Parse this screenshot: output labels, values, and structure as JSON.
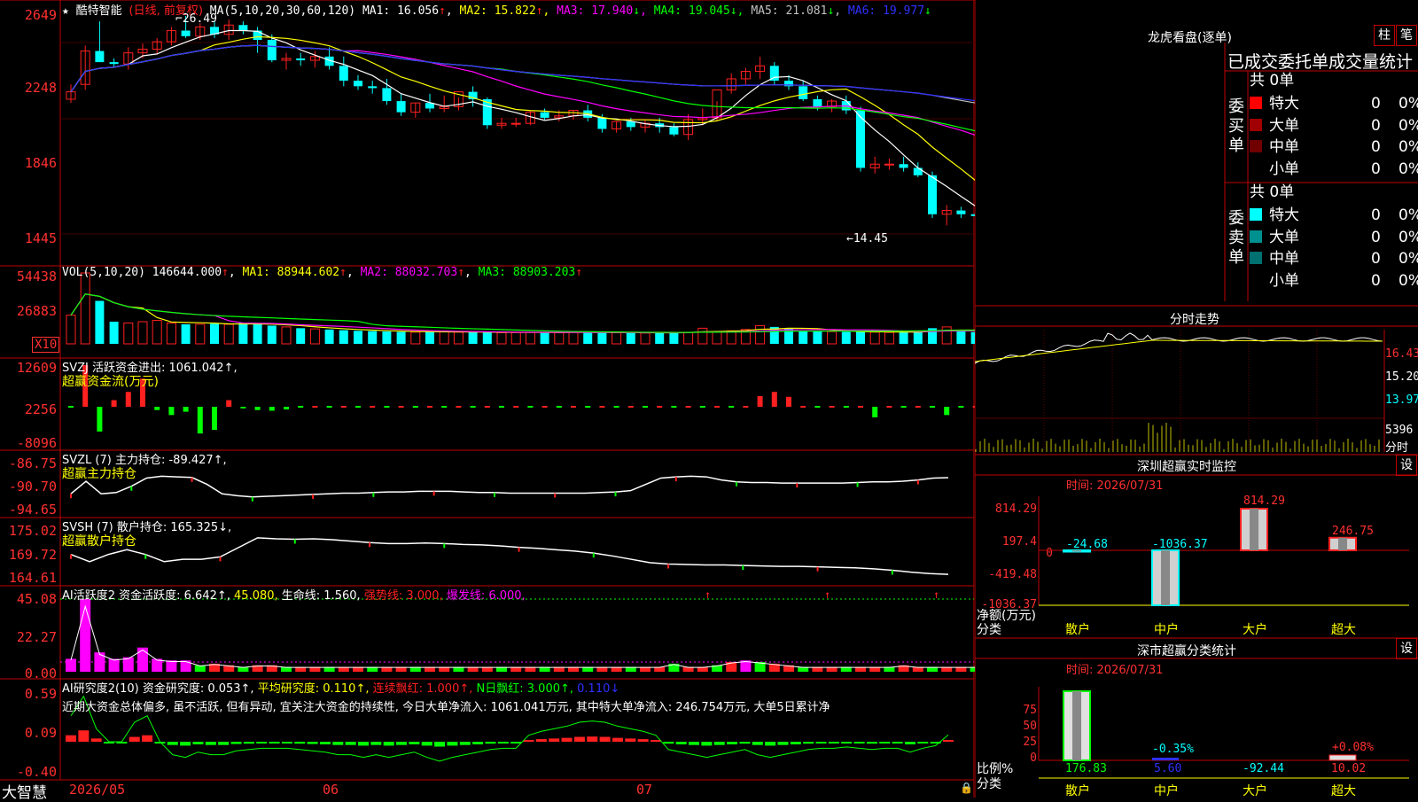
{
  "app": {
    "logo_text": "大智慧",
    "date_labels": [
      "2026/05",
      "06",
      "07"
    ]
  },
  "colors": {
    "up": "#ff2020",
    "down": "#00ffff",
    "ma1": "#ffffff",
    "ma2": "#ffff00",
    "ma3": "#ff00ff",
    "ma4": "#00ff00",
    "ma5": "#c0c0c0",
    "ma6": "#3030ff",
    "grid": "#c00000",
    "axis_text": "#ff3030"
  },
  "main": {
    "star": "★",
    "stock_name": "酷特智能",
    "period": "(日线, 前复权)",
    "ma_params": "MA(5,10,20,30,60,120)",
    "ma_values": [
      {
        "label": "MA1:",
        "value": "16.056",
        "arrow": "↑"
      },
      {
        "label": "MA2:",
        "value": "15.822",
        "arrow": "↑"
      },
      {
        "label": "MA3:",
        "value": "17.940",
        "arrow": "↓"
      },
      {
        "label": "MA4:",
        "value": "19.045",
        "arrow": "↓"
      },
      {
        "label": "MA5:",
        "value": "21.081",
        "arrow": "↓"
      },
      {
        "label": "MA6:",
        "value": "19.977",
        "arrow": "↓"
      }
    ],
    "y_ticks": [
      "2649",
      "2248",
      "1846",
      "1445"
    ],
    "high_label": "26.49",
    "low_label": "←14.45"
  },
  "volume": {
    "title": "VOL(5,10,20)",
    "value": "146644.000",
    "items": [
      {
        "label": "MA1:",
        "value": "88944.602",
        "arrow": "↑"
      },
      {
        "label": "MA2:",
        "value": "88032.703",
        "arrow": "↑"
      },
      {
        "label": "MA3:",
        "value": "88903.203",
        "arrow": "↑"
      }
    ],
    "y_ticks": [
      "54438",
      "26883"
    ],
    "unit": "X10"
  },
  "svzj": {
    "title": "SVZJ  活跃资金进出: 1061.042↑,",
    "subtitle": "超赢资金流(万元)",
    "y_ticks": [
      "12609",
      "2256",
      "-8096"
    ]
  },
  "svzl": {
    "title": "SVZL (7) 主力持仓: -89.427↑,",
    "subtitle": "超赢主力持仓",
    "y_ticks": [
      "-86.75",
      "-90.70",
      "-94.65"
    ]
  },
  "svsh": {
    "title": "SVSH (7) 散户持仓: 165.325↓,",
    "subtitle": "超赢散户持仓",
    "y_ticks": [
      "175.02",
      "169.72",
      "164.61"
    ]
  },
  "ai_active": {
    "title": "AI活跃度2 资金活跃度: 6.642↑,",
    "v2": "45.080,",
    "v3": "生命线: 1.560,",
    "v4": "强势线: 3.000,",
    "v5": "爆发线: 6.000,",
    "y_ticks": [
      "45.08",
      "22.27",
      "0.00"
    ]
  },
  "ai_research": {
    "title": "AI研究度2(10) 资金研究度: 0.053↑,",
    "v2": "平均研究度: 0.110↑,",
    "v3": "连续飘红: 1.000↑,",
    "v4": "N日飘红: 3.000↑,",
    "v5": "0.110↓",
    "note": "近期大资金总体偏多, 虽不活跃, 但有异动, 宜关注大资金的持续性, 今日大单净流入: 1061.041万元, 其中特大单净流入: 246.754万元, 大单5日累计净",
    "y_ticks": [
      "0.59",
      "0.09",
      "-0.40"
    ]
  },
  "lhb": {
    "title": "龙虎看盘(逐单)",
    "btn1": "柱",
    "btn2": "笔",
    "header": "已成交委托单成交量统计",
    "buy_label": "委买单",
    "sell_label": "委卖单",
    "buy_total": "共 0单",
    "sell_total": "共 0单",
    "buy_rows": [
      {
        "name": "特大",
        "count": "0",
        "pct": "0%",
        "color": "#ff0000"
      },
      {
        "name": "大单",
        "count": "0",
        "pct": "0%",
        "color": "#a00000"
      },
      {
        "name": "中单",
        "count": "0",
        "pct": "0%",
        "color": "#700000"
      },
      {
        "name": "小单",
        "count": "0",
        "pct": "0%",
        "color": "#000000"
      }
    ],
    "sell_rows": [
      {
        "name": "特大",
        "count": "0",
        "pct": "0%",
        "color": "#00ffff"
      },
      {
        "name": "大单",
        "count": "0",
        "pct": "0%",
        "color": "#009090"
      },
      {
        "name": "中单",
        "count": "0",
        "pct": "0%",
        "color": "#007070"
      },
      {
        "name": "小单",
        "count": "0",
        "pct": "0%",
        "color": "#000000"
      }
    ]
  },
  "intraday": {
    "title": "分时走势",
    "y_ticks": [
      "16.43",
      "15.20",
      "13.97"
    ],
    "vol_label": "5396",
    "corner_label": "分时"
  },
  "sz_monitor": {
    "title": "深圳超赢实时监控",
    "btn": "设",
    "time_label": "时间: 2026/07/31",
    "y_ticks": [
      "814.29",
      "197.4",
      "0",
      "-419.48",
      "-1036.37"
    ],
    "y_title": "净额(万元)",
    "x_title": "分类",
    "categories": [
      "散户",
      "中户",
      "大户",
      "超大"
    ],
    "values": [
      -24.68,
      -1036.37,
      814.29,
      246.75
    ],
    "value_labels": [
      "-24.68",
      "-1036.37",
      "814.29",
      "246.75"
    ]
  },
  "sz_class": {
    "title": "深市超赢分类统计",
    "btn": "设",
    "time_label": "时间: 2026/07/31",
    "y_ticks": [
      "75",
      "50",
      "25",
      "0"
    ],
    "y_title": "比例%",
    "x_title": "分类",
    "categories": [
      "散户",
      "中户",
      "大户",
      "超大"
    ],
    "bar_labels": [
      "",
      "-0.35%",
      "",
      "+0.08%"
    ],
    "bottom_values": [
      "176.83",
      "5.60",
      "-92.44",
      "10.02"
    ]
  },
  "chart_data": [
    {
      "type": "candlestick",
      "title": "酷特智能 (日线, 前复权)",
      "x_labels": [
        "2026/05",
        "06",
        "07"
      ],
      "ylim": [
        14.45,
        26.49
      ],
      "series": [
        {
          "name": "K",
          "open": [
            22.0,
            22.8,
            24.6,
            24.0,
            23.9,
            24.5,
            24.7,
            25.1,
            25.7,
            25.4,
            25.9,
            25.5,
            26.0,
            25.7,
            25.2,
            24.1,
            24.2,
            24.1,
            24.3,
            23.8,
            23.0,
            22.7,
            22.6,
            21.9,
            21.3,
            21.8,
            21.5,
            21.6,
            22.4,
            22.0,
            20.6,
            20.7,
            20.7,
            21.3,
            21.0,
            21.1,
            21.4,
            21.0,
            20.4,
            20.8,
            20.5,
            20.7,
            20.5,
            20.1,
            20.9,
            21.0,
            22.5,
            23.1,
            23.5,
            23.8,
            23.0,
            22.7,
            22.0,
            21.6,
            21.9,
            21.4,
            18.3,
            18.5,
            18.5,
            18.3,
            17.9,
            15.8,
            16.0,
            15.8,
            15.7,
            15.4,
            15.4,
            15.9,
            15.8,
            16.0,
            16.3,
            16.1,
            17.1
          ],
          "high": [
            22.8,
            24.9,
            26.2,
            24.2,
            24.8,
            25.0,
            25.3,
            25.9,
            26.49,
            26.1,
            26.2,
            26.3,
            26.2,
            25.9,
            25.5,
            24.5,
            24.5,
            24.6,
            24.8,
            24.3,
            23.3,
            23.0,
            23.1,
            22.3,
            21.8,
            22.3,
            22.2,
            22.1,
            22.7,
            22.1,
            21.0,
            21.0,
            21.4,
            21.5,
            21.4,
            21.4,
            21.7,
            21.2,
            20.8,
            21.0,
            20.9,
            21.0,
            20.7,
            21.2,
            21.5,
            21.9,
            23.4,
            23.7,
            24.3,
            24.0,
            23.3,
            23.0,
            22.2,
            22.0,
            22.2,
            21.6,
            18.9,
            18.8,
            18.9,
            18.6,
            18.1,
            16.3,
            16.2,
            16.0,
            15.9,
            15.6,
            15.9,
            16.3,
            16.2,
            16.4,
            16.8,
            17.5,
            17.3
          ],
          "low": [
            21.8,
            22.5,
            24.2,
            23.7,
            23.6,
            24.2,
            24.4,
            24.9,
            25.3,
            25.2,
            25.3,
            25.2,
            25.5,
            24.5,
            24.0,
            23.6,
            23.8,
            23.7,
            23.6,
            22.7,
            22.5,
            22.3,
            21.7,
            21.1,
            21.0,
            21.3,
            21.3,
            21.4,
            21.6,
            20.4,
            20.4,
            20.5,
            20.6,
            20.9,
            20.8,
            20.9,
            20.8,
            20.2,
            20.2,
            20.3,
            20.2,
            20.2,
            20.0,
            19.8,
            20.6,
            20.8,
            22.3,
            22.8,
            23.1,
            22.8,
            22.5,
            21.9,
            21.4,
            21.3,
            21.2,
            18.1,
            18.0,
            18.2,
            18.1,
            17.8,
            15.6,
            15.2,
            15.6,
            15.5,
            15.2,
            15.1,
            15.3,
            15.6,
            15.6,
            15.7,
            16.0,
            15.6,
            16.2
          ],
          "close": [
            22.4,
            24.6,
            24.0,
            23.9,
            24.5,
            24.7,
            25.1,
            25.7,
            25.4,
            25.9,
            25.5,
            26.0,
            25.7,
            25.2,
            24.1,
            24.2,
            24.1,
            24.3,
            23.8,
            23.0,
            22.7,
            22.6,
            21.9,
            21.3,
            21.8,
            21.5,
            21.6,
            22.4,
            22.0,
            20.6,
            20.7,
            20.7,
            21.3,
            21.0,
            21.1,
            21.4,
            21.0,
            20.4,
            20.8,
            20.5,
            20.7,
            20.5,
            20.1,
            20.9,
            21.0,
            22.5,
            23.1,
            23.5,
            23.8,
            23.0,
            22.7,
            22.0,
            21.6,
            21.9,
            21.4,
            18.3,
            18.5,
            18.5,
            18.3,
            17.9,
            15.8,
            16.0,
            15.8,
            15.7,
            15.4,
            15.4,
            15.9,
            15.8,
            16.0,
            16.3,
            16.1,
            17.1,
            17.4
          ]
        }
      ]
    },
    {
      "type": "bar",
      "title": "VOL(5,10,20)",
      "ylim": [
        0,
        54438
      ],
      "series": [
        {
          "name": "VOL",
          "values": [
            22000,
            54438,
            33000,
            17000,
            16000,
            17000,
            18000,
            16000,
            15000,
            15000,
            15500,
            15000,
            16000,
            15000,
            14000,
            13000,
            12000,
            11500,
            11000,
            10500,
            10000,
            9800,
            9500,
            9200,
            9000,
            9200,
            9300,
            9000,
            8900,
            8800,
            8600,
            8700,
            8800,
            8700,
            8600,
            8900,
            9000,
            8700,
            8500,
            8400,
            8300,
            8600,
            8800,
            8900,
            12000,
            9000,
            10000,
            11000,
            14000,
            13000,
            12000,
            9800,
            9500,
            9400,
            9300,
            9200,
            9000,
            8800,
            9000,
            9100,
            12000,
            13000,
            9800,
            9000,
            8900,
            8800,
            8700,
            8600,
            9000,
            9200,
            9400,
            9600,
            14664
          ]
        }
      ]
    },
    {
      "type": "bar",
      "title": "SVZJ 活跃资金进出",
      "ylim": [
        -8096,
        12609
      ],
      "series": [
        {
          "name": "超赢资金流(万元)",
          "values": [
            0,
            12609,
            -7500,
            2000,
            4500,
            8500,
            -1000,
            -2500,
            -1500,
            -8096,
            -7000,
            2000,
            -500,
            -1000,
            -1200,
            -800,
            0,
            0,
            0,
            0,
            0,
            0,
            0,
            0,
            0,
            0,
            0,
            0,
            0,
            0,
            0,
            0,
            0,
            0,
            0,
            0,
            0,
            0,
            0,
            0,
            0,
            0,
            0,
            0,
            0,
            0,
            0,
            0,
            3200,
            4500,
            3000,
            0,
            0,
            0,
            0,
            0,
            -3200,
            0,
            0,
            0,
            0,
            -2500,
            0,
            0,
            0,
            0,
            0,
            0,
            0,
            0,
            0,
            0,
            1061
          ]
        }
      ]
    },
    {
      "type": "line",
      "title": "SVZL (7) 主力持仓",
      "ylim": [
        -94.65,
        -86.75
      ],
      "series": [
        {
          "name": "超赢主力持仓",
          "values": [
            -92.0,
            -90.0,
            -92.0,
            -91.8,
            -90.8,
            -89.5,
            -89.2,
            -89.3,
            -89.4,
            -90.5,
            -92.0,
            -92.3,
            -92.5,
            -92.4,
            -92.3,
            -92.2,
            -92.1,
            -92.0,
            -91.9,
            -91.9,
            -91.8,
            -91.7,
            -91.7,
            -91.6,
            -91.6,
            -91.6,
            -91.7,
            -91.8,
            -91.8,
            -91.9,
            -91.9,
            -91.9,
            -91.9,
            -91.9,
            -91.9,
            -91.8,
            -91.7,
            -91.5,
            -90.5,
            -89.5,
            -89.3,
            -89.2,
            -89.3,
            -89.8,
            -90.1,
            -90.2,
            -90.2,
            -90.3,
            -90.3,
            -90.3,
            -90.3,
            -90.3,
            -90.2,
            -90.1,
            -90.1,
            -90.0,
            -89.8,
            -89.5,
            -89.427
          ]
        }
      ]
    },
    {
      "type": "line",
      "title": "SVSH (7) 散户持仓",
      "ylim": [
        164.61,
        175.02
      ],
      "series": [
        {
          "name": "超赢散户持仓",
          "values": [
            169.5,
            168.0,
            169.5,
            170.5,
            169.5,
            168.0,
            168.5,
            168.5,
            169.0,
            171.0,
            173.0,
            172.8,
            172.7,
            172.8,
            172.6,
            172.3,
            172.0,
            171.8,
            171.8,
            171.9,
            171.8,
            171.6,
            171.5,
            171.3,
            171.0,
            170.8,
            170.5,
            170.2,
            169.8,
            169.2,
            168.5,
            167.8,
            167.5,
            167.4,
            167.3,
            167.3,
            167.2,
            167.1,
            167.0,
            167.0,
            166.9,
            166.8,
            166.7,
            166.5,
            166.2,
            165.8,
            165.5,
            165.325
          ]
        }
      ]
    },
    {
      "type": "bar",
      "title": "AI活跃度2 资金活跃度",
      "ylim": [
        0,
        45.08
      ],
      "series": [
        {
          "name": "资金活跃度",
          "values": [
            8,
            45.08,
            12,
            8,
            9,
            15,
            8,
            7,
            7,
            4,
            5,
            4,
            3,
            4,
            4,
            3,
            3,
            3,
            3,
            3,
            3,
            3,
            3,
            3,
            3,
            3,
            3,
            3,
            3,
            3,
            3,
            3,
            3,
            3,
            3,
            3,
            3,
            3,
            3,
            3,
            3,
            3,
            5,
            3,
            3,
            4,
            6,
            7,
            6,
            5,
            4,
            3,
            3,
            3,
            3,
            3,
            3,
            3,
            4,
            3,
            3,
            3,
            3,
            3,
            3,
            3,
            3,
            3,
            3,
            3,
            3,
            3,
            6.642
          ]
        }
      ]
    },
    {
      "type": "bar",
      "title": "AI研究度2(10) 资金研究度",
      "ylim": [
        -0.4,
        0.59
      ],
      "series": [
        {
          "name": "资金研究度",
          "values": [
            0.2,
            0.35,
            0.1,
            0,
            0,
            0.15,
            0.2,
            0,
            -0.1,
            -0.12,
            -0.08,
            -0.1,
            -0.1,
            -0.07,
            -0.06,
            -0.05,
            -0.05,
            -0.05,
            -0.06,
            -0.07,
            -0.08,
            -0.1,
            -0.1,
            -0.12,
            -0.1,
            -0.12,
            -0.1,
            -0.08,
            -0.12,
            -0.15,
            -0.12,
            -0.1,
            -0.08,
            -0.06,
            -0.05,
            -0.05,
            0.05,
            0.08,
            0.1,
            0.12,
            0.15,
            0.16,
            0.15,
            0.12,
            0.1,
            0.08,
            0.05,
            -0.06,
            -0.08,
            -0.1,
            -0.12,
            -0.1,
            -0.08,
            -0.06,
            -0.1,
            -0.12,
            -0.1,
            -0.08,
            -0.06,
            -0.05,
            -0.05,
            -0.04,
            -0.05,
            -0.06,
            -0.05,
            -0.05,
            -0.08,
            -0.05,
            -0.03,
            0.053
          ]
        }
      ]
    }
  ]
}
